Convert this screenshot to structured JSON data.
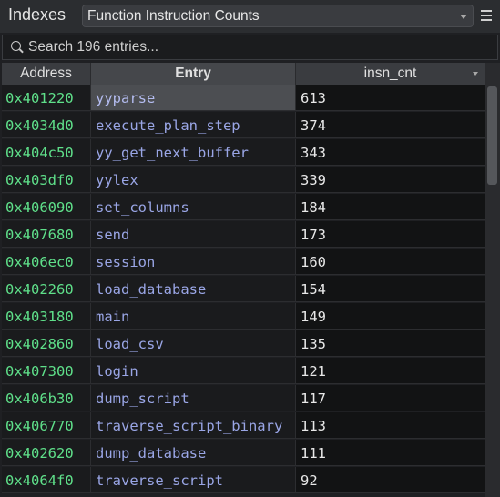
{
  "header": {
    "title": "Indexes",
    "selected_index": "Function Instruction Counts"
  },
  "search": {
    "placeholder": "Search 196 entries..."
  },
  "table": {
    "columns": [
      "Address",
      "Entry",
      "insn_cnt"
    ],
    "rows": [
      {
        "address": "0x401220",
        "entry": "yyparse",
        "insn_cnt": "613"
      },
      {
        "address": "0x4034d0",
        "entry": "execute_plan_step",
        "insn_cnt": "374"
      },
      {
        "address": "0x404c50",
        "entry": "yy_get_next_buffer",
        "insn_cnt": "343"
      },
      {
        "address": "0x403df0",
        "entry": "yylex",
        "insn_cnt": "339"
      },
      {
        "address": "0x406090",
        "entry": "set_columns",
        "insn_cnt": "184"
      },
      {
        "address": "0x407680",
        "entry": "send",
        "insn_cnt": "173"
      },
      {
        "address": "0x406ec0",
        "entry": "session",
        "insn_cnt": "160"
      },
      {
        "address": "0x402260",
        "entry": "load_database",
        "insn_cnt": "154"
      },
      {
        "address": "0x403180",
        "entry": "main",
        "insn_cnt": "149"
      },
      {
        "address": "0x402860",
        "entry": "load_csv",
        "insn_cnt": "135"
      },
      {
        "address": "0x407300",
        "entry": "login",
        "insn_cnt": "121"
      },
      {
        "address": "0x406b30",
        "entry": "dump_script",
        "insn_cnt": "117"
      },
      {
        "address": "0x406770",
        "entry": "traverse_script_binary",
        "insn_cnt": "113"
      },
      {
        "address": "0x402620",
        "entry": "dump_database",
        "insn_cnt": "111"
      },
      {
        "address": "0x4064f0",
        "entry": "traverse_script",
        "insn_cnt": "92"
      }
    ]
  },
  "colors": {
    "address": "#5fe08a",
    "entry": "#9aa6e6",
    "selected_row_bg": "#4c4e52"
  }
}
